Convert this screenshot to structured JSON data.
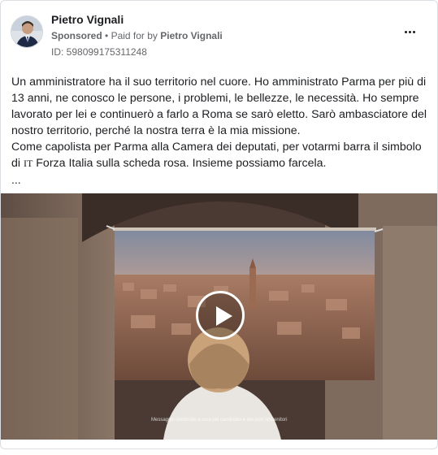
{
  "post": {
    "author": "Pietro Vignali",
    "sponsored_label": "Sponsored",
    "separator": "•",
    "paid_for_by_label": "Paid for by",
    "paid_for_by_name": "Pietro Vignali",
    "ad_id": "ID: 598099175311248",
    "more_icon": "more-horizontal-icon",
    "body_paragraphs": [
      "Un amministratore ha il suo territorio nel cuore. Ho amministrato Parma per più di 13 anni, ne conosco le persone, i problemi, le bellezze, le necessità. Ho sempre lavorato per lei e continuerò a farlo a Roma se sarò eletto. Sarò ambasciatore del nostro territorio, perché la nostra terra è la mia missione.",
      "Come capolista per Parma alla Camera dei deputati, per votarmi barra il simbolo di ",
      "Forza Italia sulla scheda rosa. Insieme possiamo farcela."
    ],
    "inline_symbol": "ΙΤ",
    "see_more": "...",
    "video": {
      "play_icon": "play-icon",
      "caption": "Messaggio elettorale a cura del candidato e dei suoi sostenitori"
    }
  }
}
